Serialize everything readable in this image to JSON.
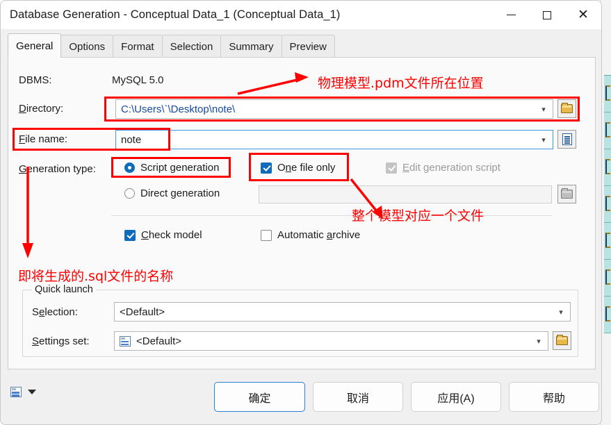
{
  "window": {
    "title": "Database Generation - Conceptual Data_1 (Conceptual Data_1)",
    "minimize_label": "Minimize",
    "maximize_label": "Maximize",
    "close_label": "Close"
  },
  "tabs": [
    {
      "label": "General",
      "active": true
    },
    {
      "label": "Options",
      "active": false
    },
    {
      "label": "Format",
      "active": false
    },
    {
      "label": "Selection",
      "active": false
    },
    {
      "label": "Summary",
      "active": false
    },
    {
      "label": "Preview",
      "active": false
    }
  ],
  "form": {
    "dbms_label": "DBMS:",
    "dbms_value": "MySQL 5.0",
    "directory_label": "Directory:",
    "directory_value": "C:\\Users\\`\\Desktop\\note\\",
    "filename_label": "File name:",
    "filename_value": "note",
    "generation_type_label": "Generation type:",
    "script_generation_label": "Script generation",
    "script_generation_checked": true,
    "direct_generation_label": "Direct generation",
    "direct_generation_checked": false,
    "one_file_only_label": "One file only",
    "one_file_only_checked": true,
    "edit_generation_script_label": "Edit generation script",
    "edit_generation_script_checked": true,
    "edit_generation_script_disabled": true,
    "direct_target_value": "",
    "check_model_label": "Check model",
    "check_model_checked": true,
    "automatic_archive_label": "Automatic archive",
    "automatic_archive_checked": false
  },
  "quick_launch": {
    "group_title": "Quick launch",
    "selection_label": "Selection:",
    "selection_value": "<Default>",
    "settings_set_label": "Settings set:",
    "settings_set_value": "<Default>"
  },
  "buttons": {
    "ok": "确定",
    "cancel": "取消",
    "apply": "应用(A)",
    "help": "帮助"
  },
  "annotations": [
    {
      "text": "物理模型.pdm文件所在位置"
    },
    {
      "text": "整个模型对应一个文件"
    },
    {
      "text": "即将生成的.sql文件的名称"
    }
  ],
  "colors": {
    "annotation_red": "#ff0000",
    "accent_blue": "#0f6cbd",
    "focus_blue": "#3b9ae1",
    "link_blue": "#16489c"
  }
}
